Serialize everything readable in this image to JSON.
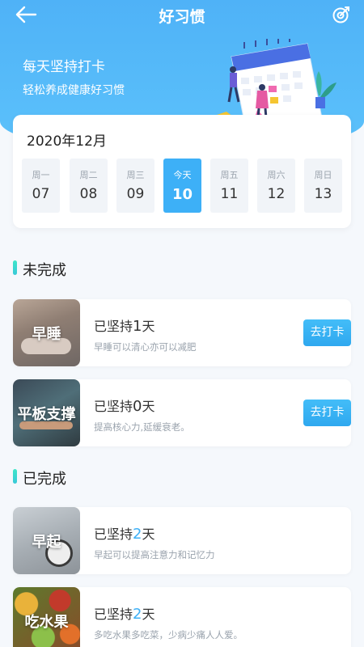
{
  "header": {
    "title": "好习惯",
    "slogan_main": "每天坚持打卡",
    "slogan_sub": "轻松养成健康好习惯"
  },
  "calendar": {
    "month": "2020年12月",
    "days": [
      {
        "weekday": "周一",
        "date": "07"
      },
      {
        "weekday": "周二",
        "date": "08"
      },
      {
        "weekday": "周三",
        "date": "09"
      },
      {
        "weekday": "今天",
        "date": "10",
        "today": true
      },
      {
        "weekday": "周五",
        "date": "11"
      },
      {
        "weekday": "周六",
        "date": "12"
      },
      {
        "weekday": "周日",
        "date": "13"
      }
    ]
  },
  "sections": {
    "pending_title": "未完成",
    "done_title": "已完成"
  },
  "streak_prefix": "已坚持",
  "streak_suffix": "天",
  "pending": [
    {
      "name": "早睡",
      "days": "1",
      "desc": "早睡可以清心亦可以减肥",
      "button": "去打卡"
    },
    {
      "name": "平板支撑",
      "days": "0",
      "desc": "提高核心力,延缓衰老。",
      "button": "去打卡"
    }
  ],
  "done": [
    {
      "name": "早起",
      "days": "2",
      "desc": "早起可以提高注意力和记忆力"
    },
    {
      "name": "吃水果",
      "days": "2",
      "desc": "多吃水果多吃菜，少病少痛人人爱。"
    }
  ],
  "colors": {
    "accent": "#3db0f7",
    "header": "#4fb2f7",
    "section_bar": "#3ee6c9"
  },
  "icons": {
    "back": "back-arrow-icon",
    "checkin": "checkin-target-icon"
  }
}
